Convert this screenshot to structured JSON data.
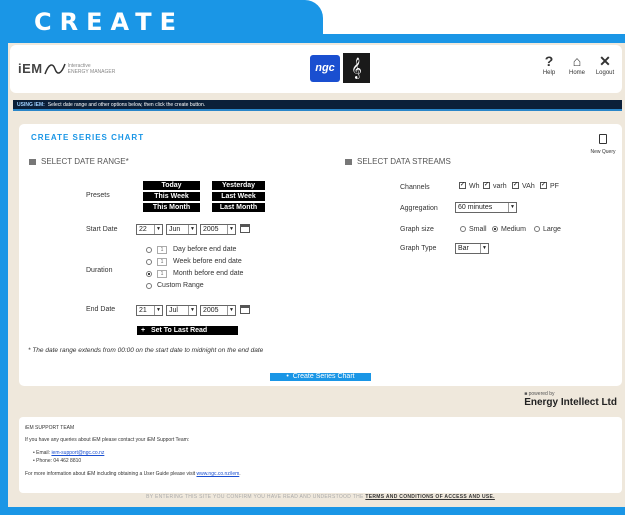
{
  "tab": {
    "title": "CREATE"
  },
  "header": {
    "logo_text": "iEM",
    "logo_sub_1": "Interactive",
    "logo_sub_2": "ENERGY MANAGER",
    "ngc": "ngc",
    "tools": [
      {
        "icon": "help-icon",
        "glyph": "?",
        "label": "Help"
      },
      {
        "icon": "home-icon",
        "glyph": "⌂",
        "label": "Home"
      },
      {
        "icon": "logout-icon",
        "glyph": "✕",
        "label": "Logout"
      }
    ]
  },
  "instructions": {
    "prefix": "USING IEM:",
    "text": "Select date range and other options below, then click the create button."
  },
  "panel": {
    "title": "CREATE SERIES CHART",
    "new_query": "New Query",
    "date_section": "SELECT DATE RANGE*",
    "data_section": "SELECT DATA STREAMS",
    "presets_label": "Presets",
    "presets": [
      "Today",
      "Yesterday",
      "This Week",
      "Last Week",
      "This Month",
      "Last Month"
    ],
    "start_label": "Start Date",
    "start": {
      "day": "22",
      "month": "Jun",
      "year": "2005"
    },
    "duration_label": "Duration",
    "duration_options": [
      {
        "value": "1",
        "label": "Day before end date",
        "selected": false
      },
      {
        "value": "1",
        "label": "Week before end date",
        "selected": false
      },
      {
        "value": "1",
        "label": "Month before end date",
        "selected": true
      },
      {
        "value": "",
        "label": "Custom Range",
        "selected": false
      }
    ],
    "end_label": "End Date",
    "end": {
      "day": "21",
      "month": "Jul",
      "year": "2005"
    },
    "set_last_read": "Set To Last Read",
    "note": "* The date range extends from 00:00 on the start date to midnight on the end date",
    "channels_label": "Channels",
    "channels": [
      {
        "label": "Wh",
        "checked": true
      },
      {
        "label": "varh",
        "checked": true
      },
      {
        "label": "VAh",
        "checked": true
      },
      {
        "label": "PF",
        "checked": true
      }
    ],
    "aggregation_label": "Aggregation",
    "aggregation": "60 minutes",
    "graph_size_label": "Graph size",
    "graph_sizes": [
      {
        "label": "Small",
        "selected": false
      },
      {
        "label": "Medium",
        "selected": true
      },
      {
        "label": "Large",
        "selected": false
      }
    ],
    "graph_type_label": "Graph Type",
    "graph_type": "Bar",
    "create_button": "Create Series Chart"
  },
  "powered": {
    "small": "powered by",
    "big": "Energy Intellect Ltd"
  },
  "support": {
    "title": "iEM SUPPORT TEAM",
    "intro": "If you have any queries about iEM please contact your iEM Support Team:",
    "email_label": "Email:",
    "email": "iem-support@ngc.co.nz",
    "phone": "Phone: 04 462 8810",
    "more": "For more information about iEM including obtaining a User Guide please visit",
    "url": "www.ngc.co.nz/iem"
  },
  "footer": {
    "text": "BY ENTERING THIS SITE YOU CONFIRM YOU HAVE READ AND UNDERSTOOD THE",
    "terms": "TERMS AND CONDITIONS OF ACCESS AND USE."
  }
}
